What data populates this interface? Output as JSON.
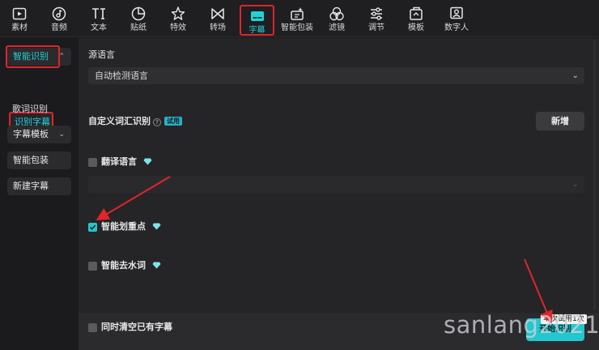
{
  "toolbar": {
    "items": [
      {
        "label": "素材",
        "icon": "media-icon"
      },
      {
        "label": "音频",
        "icon": "audio-icon"
      },
      {
        "label": "文本",
        "icon": "text-icon"
      },
      {
        "label": "贴纸",
        "icon": "sticker-icon"
      },
      {
        "label": "特效",
        "icon": "effects-icon"
      },
      {
        "label": "转场",
        "icon": "transition-icon"
      },
      {
        "label": "字幕",
        "icon": "subtitle-icon"
      },
      {
        "label": "智能包装",
        "icon": "smart-pack-icon"
      },
      {
        "label": "滤镜",
        "icon": "filter-icon"
      },
      {
        "label": "调节",
        "icon": "adjust-icon"
      },
      {
        "label": "模板",
        "icon": "template-icon"
      },
      {
        "label": "数字人",
        "icon": "digital-human-icon"
      }
    ],
    "active_label": "字幕"
  },
  "sidebar": {
    "group_smart": "智能识别",
    "item_subtitle_recognition": "识别字幕",
    "item_lyrics_recognition": "歌词识别",
    "group_template": "字幕模板",
    "group_smart_pack": "智能包装",
    "new_subtitle": "新建字幕"
  },
  "main": {
    "source_language_label": "源语言",
    "source_language_value": "自动检测语言",
    "custom_vocab_label": "自定义词汇识别",
    "custom_vocab_badge": "试用",
    "add_button": "新增",
    "translate_label": "翻译语言",
    "translate_value": "",
    "highlight_label": "智能划重点",
    "highlight_checked": true,
    "remove_filler_label": "智能去水词",
    "remove_filler_checked": false,
    "clear_existing_label": "同时清空已有字幕",
    "clear_existing_checked": false,
    "start_button": "开始识别",
    "tooltip": "本次试用1次"
  },
  "watermark": "sanlang2021",
  "colors": {
    "accent": "#22d3d6",
    "annotation_red": "#e0252b",
    "panel": "#252527",
    "toolbar": "#1f1f21"
  }
}
